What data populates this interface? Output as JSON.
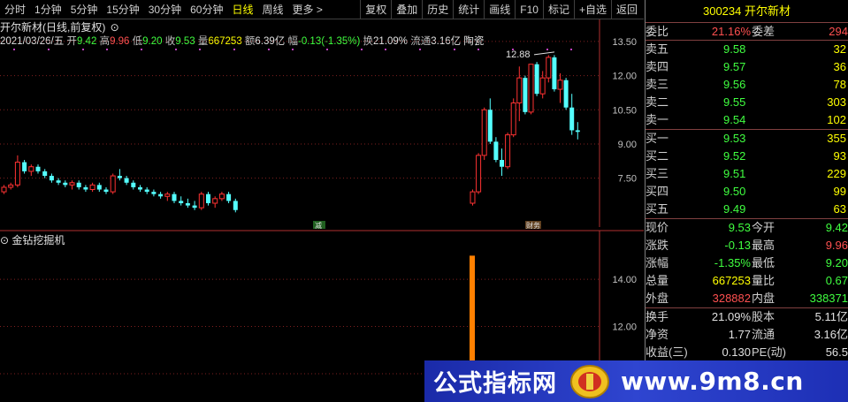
{
  "toolbar": {
    "periods": [
      "分时",
      "1分钟",
      "5分钟",
      "15分钟",
      "30分钟",
      "60分钟",
      "日线",
      "周线",
      "更多 >"
    ],
    "active_period": "日线",
    "actions": [
      "复权",
      "叠加",
      "历史",
      "统计",
      "画线",
      "F10",
      "标记",
      "+自选",
      "返回"
    ]
  },
  "chart": {
    "stock_title": "开尔新材(日线,前复权)",
    "info": {
      "date": "2021/03/26/五",
      "open_label": "开",
      "open": "9.42",
      "high_label": "高",
      "high": "9.96",
      "low_label": "低",
      "low": "9.20",
      "close_label": "收",
      "close": "9.53",
      "vol_label": "量",
      "vol": "667253",
      "amount_label": "额",
      "amount": "6.39亿",
      "chg_label": "幅",
      "chg": "-0.13(-1.35%)",
      "turnover_label": "换",
      "turnover": "21.09%",
      "float_label": "流通",
      "float": "3.16亿",
      "concept": "陶瓷"
    },
    "peak_label": "12.88",
    "event_marks": [
      "减",
      "财务"
    ]
  },
  "indicator": {
    "name": "金钻挖掘机"
  },
  "chart_data": [
    {
      "type": "candlestick",
      "title": "开尔新材(日线,前复权)",
      "y_ticks": [
        "13.50",
        "12.00",
        "10.50",
        "9.00",
        "7.50"
      ],
      "ylim": [
        6.4,
        14.0
      ],
      "bars_left": [
        [
          6.9,
          7.2,
          6.8,
          7.1
        ],
        [
          7.1,
          7.3,
          7.0,
          7.2
        ],
        [
          7.2,
          8.5,
          7.1,
          8.2
        ],
        [
          8.2,
          8.3,
          7.7,
          7.8
        ],
        [
          7.8,
          8.1,
          7.6,
          8.0
        ],
        [
          8.0,
          8.1,
          7.7,
          7.8
        ],
        [
          7.8,
          7.9,
          7.5,
          7.6
        ],
        [
          7.6,
          7.7,
          7.3,
          7.4
        ],
        [
          7.4,
          7.5,
          7.2,
          7.3
        ],
        [
          7.3,
          7.4,
          7.1,
          7.2
        ],
        [
          7.2,
          7.4,
          7.0,
          7.3
        ],
        [
          7.3,
          7.4,
          7.0,
          7.1
        ],
        [
          7.1,
          7.2,
          6.9,
          7.0
        ],
        [
          7.0,
          7.3,
          6.9,
          7.2
        ],
        [
          7.2,
          7.3,
          6.9,
          7.0
        ],
        [
          7.0,
          7.1,
          6.8,
          6.9
        ],
        [
          6.9,
          7.7,
          6.8,
          7.6
        ],
        [
          7.6,
          7.9,
          7.4,
          7.5
        ],
        [
          7.5,
          7.6,
          7.2,
          7.3
        ],
        [
          7.3,
          7.4,
          7.0,
          7.1
        ],
        [
          7.1,
          7.2,
          6.9,
          7.0
        ],
        [
          7.0,
          7.1,
          6.8,
          6.9
        ],
        [
          6.9,
          7.0,
          6.7,
          6.8
        ],
        [
          6.8,
          6.9,
          6.6,
          6.7
        ],
        [
          6.7,
          6.9,
          6.5,
          6.8
        ],
        [
          6.8,
          6.9,
          6.4,
          6.5
        ],
        [
          6.5,
          6.7,
          6.3,
          6.4
        ],
        [
          6.4,
          6.6,
          6.2,
          6.3
        ],
        [
          6.3,
          6.5,
          6.1,
          6.2
        ],
        [
          6.2,
          6.9,
          6.1,
          6.8
        ],
        [
          6.8,
          6.9,
          6.3,
          6.4
        ],
        [
          6.4,
          6.7,
          6.2,
          6.6
        ],
        [
          6.6,
          6.9,
          6.5,
          6.8
        ],
        [
          6.8,
          6.9,
          6.4,
          6.5
        ],
        [
          6.5,
          6.6,
          6.0,
          6.1
        ]
      ],
      "bars_right": [
        [
          6.4,
          7.0,
          6.3,
          6.9
        ],
        [
          6.9,
          8.6,
          6.8,
          8.5
        ],
        [
          8.5,
          10.6,
          8.3,
          10.5
        ],
        [
          10.5,
          11.0,
          9.0,
          9.1
        ],
        [
          9.1,
          9.3,
          8.2,
          8.3
        ],
        [
          8.3,
          8.8,
          7.6,
          8.0
        ],
        [
          8.0,
          9.5,
          7.9,
          9.4
        ],
        [
          9.4,
          11.0,
          9.3,
          10.8
        ],
        [
          10.8,
          12.4,
          10.0,
          11.9
        ],
        [
          11.9,
          12.0,
          10.3,
          10.4
        ],
        [
          10.4,
          12.5,
          10.3,
          12.5
        ],
        [
          12.5,
          12.6,
          11.1,
          11.2
        ],
        [
          11.2,
          12.2,
          11.0,
          11.9
        ],
        [
          11.9,
          12.9,
          11.7,
          12.8
        ],
        [
          12.8,
          12.9,
          11.3,
          11.4
        ],
        [
          11.4,
          12.1,
          10.8,
          11.8
        ],
        [
          11.8,
          11.9,
          10.5,
          10.6
        ],
        [
          10.6,
          11.2,
          9.4,
          9.6
        ],
        [
          9.6,
          9.96,
          9.2,
          9.53
        ]
      ]
    },
    {
      "type": "bar",
      "title": "金钻挖掘机",
      "y_ticks": [
        "14.00",
        "12.00",
        "10.00"
      ],
      "ylim": [
        8.8,
        15.8
      ],
      "values": [
        15.0
      ]
    }
  ],
  "quote": {
    "code": "300234",
    "name": "开尔新材",
    "webi_label": "委比",
    "webi": "21.16%",
    "weicha_label": "委差",
    "weicha": "294",
    "asks": [
      {
        "label": "卖五",
        "price": "9.58",
        "vol": "32"
      },
      {
        "label": "卖四",
        "price": "9.57",
        "vol": "36"
      },
      {
        "label": "卖三",
        "price": "9.56",
        "vol": "78"
      },
      {
        "label": "卖二",
        "price": "9.55",
        "vol": "303"
      },
      {
        "label": "卖一",
        "price": "9.54",
        "vol": "102"
      }
    ],
    "bids": [
      {
        "label": "买一",
        "price": "9.53",
        "vol": "355"
      },
      {
        "label": "买二",
        "price": "9.52",
        "vol": "93"
      },
      {
        "label": "买三",
        "price": "9.51",
        "vol": "229"
      },
      {
        "label": "买四",
        "price": "9.50",
        "vol": "99"
      },
      {
        "label": "买五",
        "price": "9.49",
        "vol": "63"
      }
    ],
    "stats": [
      {
        "l1": "现价",
        "v1": "9.53",
        "c1": "green",
        "l2": "今开",
        "v2": "9.42",
        "c2": "green"
      },
      {
        "l1": "涨跌",
        "v1": "-0.13",
        "c1": "green",
        "l2": "最高",
        "v2": "9.96",
        "c2": "red"
      },
      {
        "l1": "涨幅",
        "v1": "-1.35%",
        "c1": "green",
        "l2": "最低",
        "v2": "9.20",
        "c2": "green"
      },
      {
        "l1": "总量",
        "v1": "667253",
        "c1": "yellow",
        "l2": "量比",
        "v2": "0.67",
        "c2": "green"
      },
      {
        "l1": "外盘",
        "v1": "328882",
        "c1": "red",
        "l2": "内盘",
        "v2": "338371",
        "c2": "green"
      }
    ],
    "fin": [
      {
        "l1": "换手",
        "v1": "21.09%",
        "l2": "股本",
        "v2": "5.11亿"
      },
      {
        "l1": "净资",
        "v1": "1.77",
        "l2": "流通",
        "v2": "3.16亿"
      },
      {
        "l1": "收益(三)",
        "v1": "0.130",
        "l2": "PE(动)",
        "v2": "56.5"
      }
    ]
  },
  "banner": {
    "text_left": "公式指标网",
    "text_right": "www.9m8.cn"
  }
}
